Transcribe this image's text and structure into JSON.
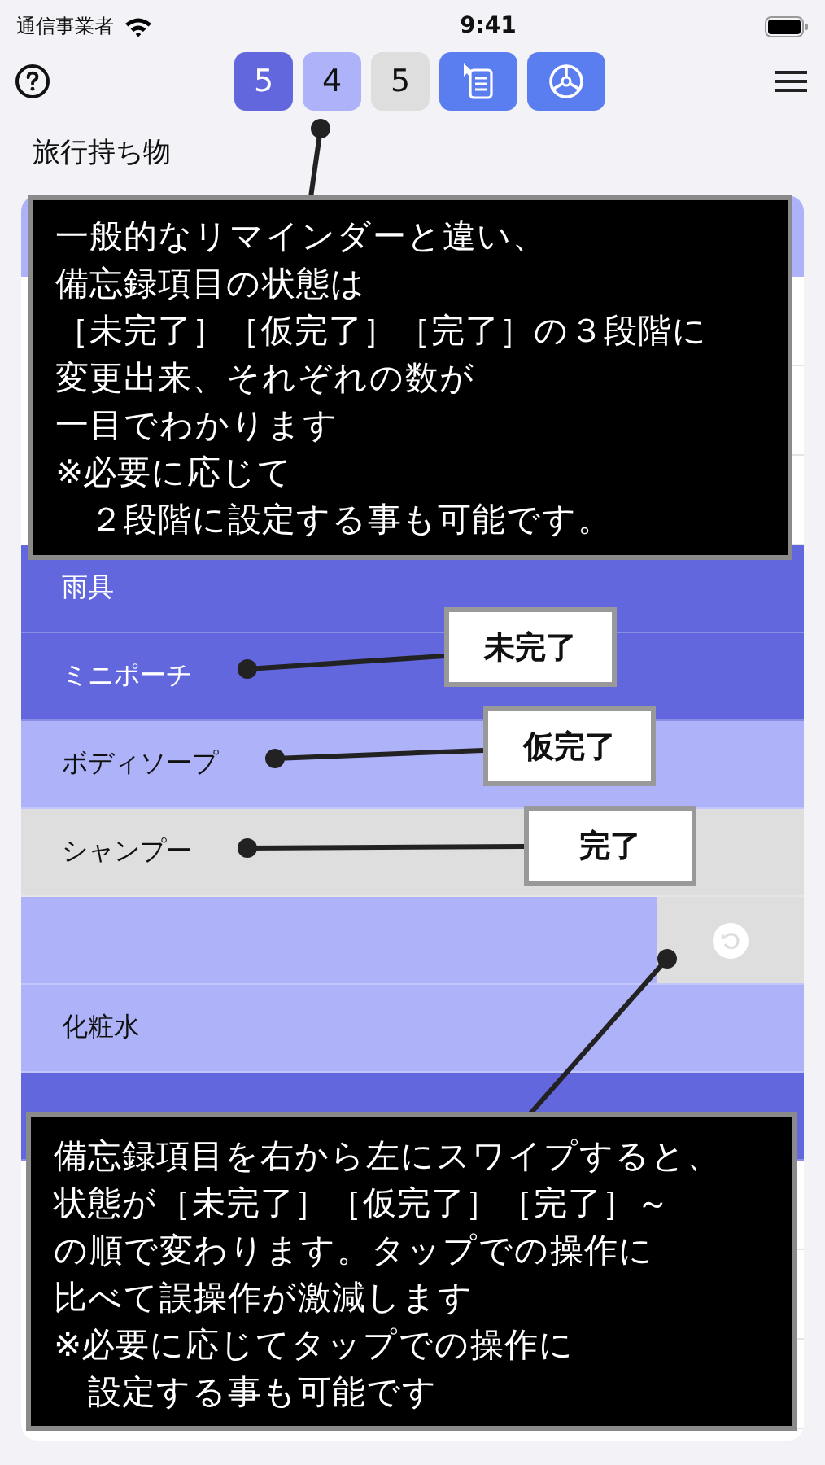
{
  "status_bar": {
    "carrier": "通信事業者",
    "time": "9:41"
  },
  "toolbar": {
    "counts": [
      {
        "kind": "incomplete",
        "value": "5"
      },
      {
        "kind": "provisional",
        "value": "4"
      },
      {
        "kind": "done",
        "value": "5"
      }
    ]
  },
  "list_title": "旅行持ち物",
  "items": [
    {
      "label": "雨具",
      "kind": "incomplete",
      "swiped": false
    },
    {
      "label": "ミニポーチ",
      "kind": "incomplete",
      "swiped": false
    },
    {
      "label": "ボディソープ",
      "kind": "provisional",
      "swiped": false
    },
    {
      "label": "シャンプー",
      "kind": "done",
      "swiped": false
    },
    {
      "kind": "provisional",
      "swiped": true
    },
    {
      "label": "化粧水",
      "kind": "provisional",
      "swiped": false
    },
    {
      "kind": "incomplete",
      "swiped": false
    }
  ],
  "callouts": [
    {
      "lines": [
        "一般的なリマインダーと違い、",
        "備忘録項目の状態は",
        "［未完了］［仮完了］［完了］の３段階に",
        "変更出来、それぞれの数が",
        "一目でわかります",
        "※必要に応じて",
        "　２段階に設定する事も可能です。"
      ]
    },
    {
      "lines": [
        "備忘録項目を右から左にスワイプすると、",
        "状態が［未完了］［仮完了］［完了］～",
        "の順で変わります。タップでの操作に",
        "比べて誤操作が激減します",
        "※必要に応じてタップでの操作に",
        "　設定する事も可能です"
      ]
    }
  ],
  "state_labels": [
    {
      "text": "未完了"
    },
    {
      "text": "仮完了"
    },
    {
      "text": "完了"
    }
  ]
}
